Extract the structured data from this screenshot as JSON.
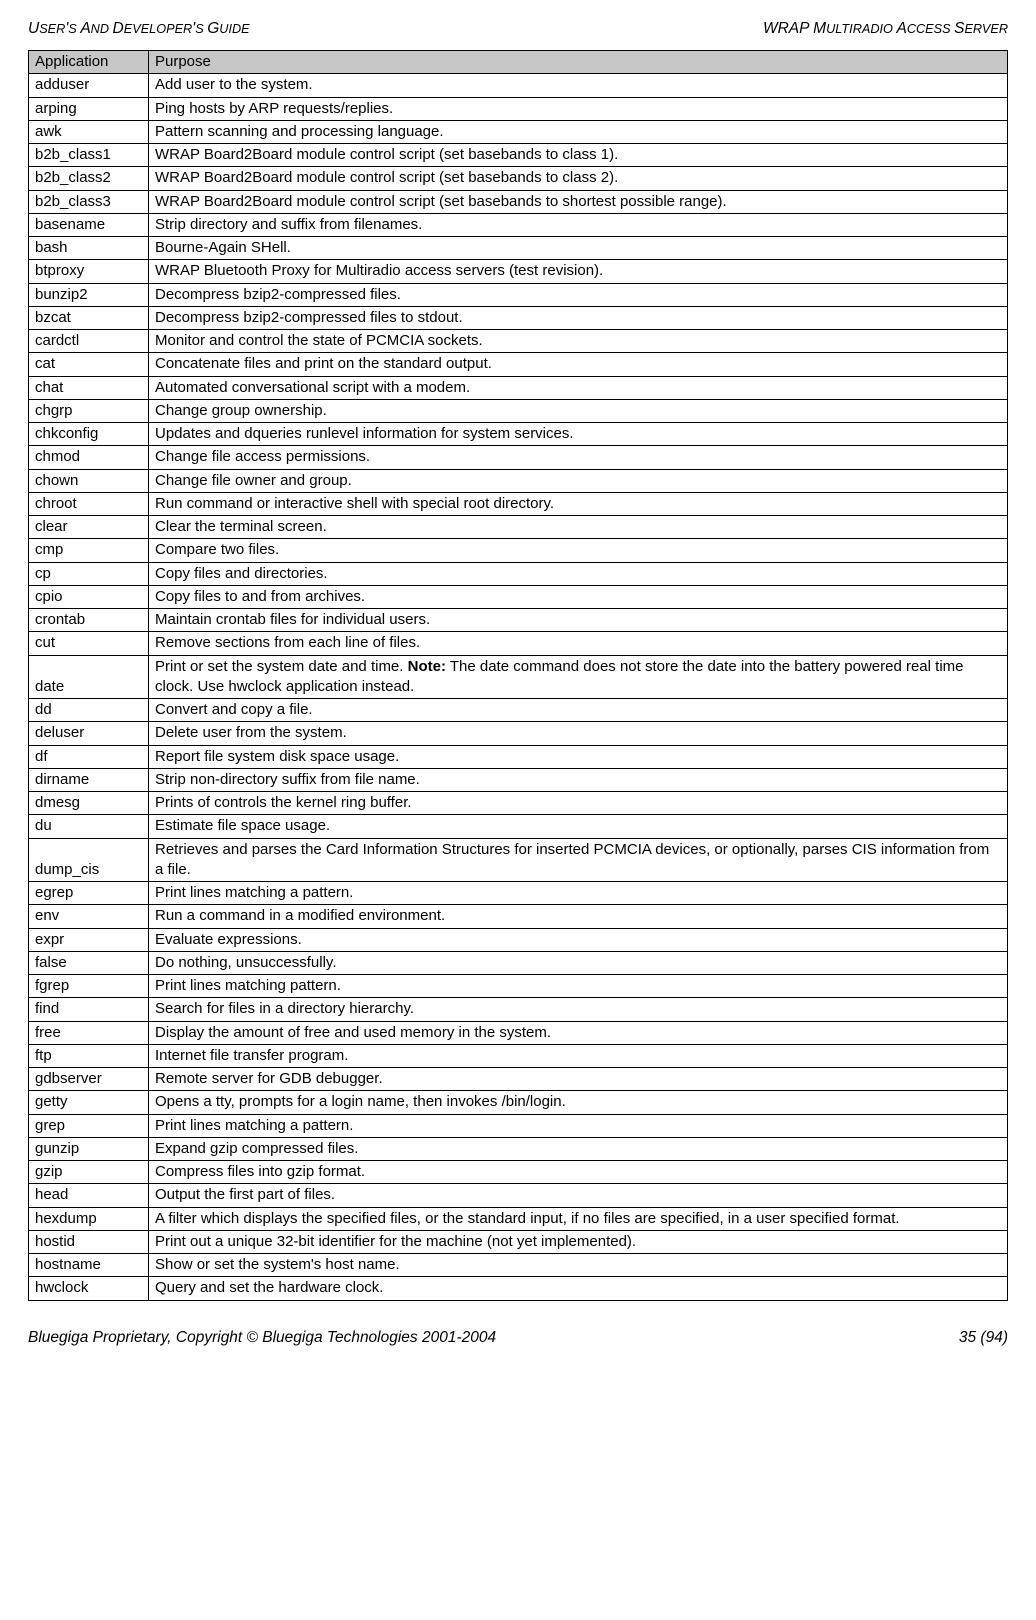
{
  "header": {
    "left_html": "U<span class='sc'>SER</span>'<span class='sc'>S</span> A<span class='sc'>ND</span> D<span class='sc'>EVELOPER</span>'<span class='sc'>S</span> G<span class='sc'>UIDE</span>",
    "left": "USER'S AND DEVELOPER'S GUIDE",
    "right": "WRAP MULTIRADIO ACCESS SERVER"
  },
  "table": {
    "headers": {
      "app": "Application",
      "purpose": "Purpose"
    },
    "rows": [
      {
        "app": "adduser",
        "purpose": "Add user to the system."
      },
      {
        "app": "arping",
        "purpose": "Ping hosts by ARP requests/replies."
      },
      {
        "app": "awk",
        "purpose": "Pattern scanning and processing language."
      },
      {
        "app": "b2b_class1",
        "purpose": "WRAP Board2Board module control script (set basebands to class 1)."
      },
      {
        "app": "b2b_class2",
        "purpose": "WRAP Board2Board module control script (set basebands to class 2)."
      },
      {
        "app": "b2b_class3",
        "purpose": "WRAP Board2Board module control script (set basebands to shortest possible range)."
      },
      {
        "app": "basename",
        "purpose": "Strip directory and suffix from filenames."
      },
      {
        "app": "bash",
        "purpose": "Bourne-Again SHell."
      },
      {
        "app": "btproxy",
        "purpose": "WRAP Bluetooth Proxy for Multiradio access servers (test revision)."
      },
      {
        "app": "bunzip2",
        "purpose": "Decompress bzip2-compressed files."
      },
      {
        "app": "bzcat",
        "purpose": "Decompress bzip2-compressed files to stdout."
      },
      {
        "app": "cardctl",
        "purpose": "Monitor and control the state of PCMCIA sockets."
      },
      {
        "app": "cat",
        "purpose": "Concatenate files and print on the standard output."
      },
      {
        "app": "chat",
        "purpose": "Automated conversational script with a modem."
      },
      {
        "app": "chgrp",
        "purpose": "Change group ownership."
      },
      {
        "app": "chkconfig",
        "purpose": "Updates and dqueries runlevel information for system services."
      },
      {
        "app": "chmod",
        "purpose": "Change file access permissions."
      },
      {
        "app": "chown",
        "purpose": "Change file owner and group."
      },
      {
        "app": "chroot",
        "purpose": "Run command or interactive shell with special root directory."
      },
      {
        "app": "clear",
        "purpose": "Clear the terminal screen."
      },
      {
        "app": "cmp",
        "purpose": "Compare two files."
      },
      {
        "app": "cp",
        "purpose": "Copy files and directories."
      },
      {
        "app": "cpio",
        "purpose": "Copy files to and from archives."
      },
      {
        "app": "crontab",
        "purpose": "Maintain crontab files for individual users."
      },
      {
        "app": "cut",
        "purpose": "Remove sections from each line of files."
      },
      {
        "app": "date",
        "purpose_html": "Print or set the system date and time. <b>Note:</b> The date command does not store the date into the battery powered real time clock. Use hwclock application instead."
      },
      {
        "app": "dd",
        "purpose": "Convert and copy a file."
      },
      {
        "app": "deluser",
        "purpose": "Delete user from the system."
      },
      {
        "app": "df",
        "purpose": "Report file system disk space usage."
      },
      {
        "app": "dirname",
        "purpose": "Strip non-directory suffix from file name."
      },
      {
        "app": "dmesg",
        "purpose": "Prints of controls the kernel ring buffer."
      },
      {
        "app": "du",
        "purpose": "Estimate file space usage."
      },
      {
        "app": "dump_cis",
        "purpose": "Retrieves and parses the Card Information Structures for inserted PCMCIA devices, or optionally, parses CIS information from a file."
      },
      {
        "app": "egrep",
        "purpose": "Print lines matching a pattern."
      },
      {
        "app": "env",
        "purpose": "Run a command in a modified environment."
      },
      {
        "app": "expr",
        "purpose": "Evaluate expressions."
      },
      {
        "app": "false",
        "purpose": "Do nothing, unsuccessfully."
      },
      {
        "app": "fgrep",
        "purpose": "Print lines matching pattern."
      },
      {
        "app": "find",
        "purpose": "Search for files in a directory hierarchy."
      },
      {
        "app": "free",
        "purpose": "Display the amount of free and used memory in the system."
      },
      {
        "app": "ftp",
        "purpose": "Internet file transfer program."
      },
      {
        "app": "gdbserver",
        "purpose": "Remote server for GDB debugger."
      },
      {
        "app": "getty",
        "purpose": "Opens a tty, prompts for a login name, then invokes /bin/login."
      },
      {
        "app": "grep",
        "purpose": "Print lines matching a pattern."
      },
      {
        "app": "gunzip",
        "purpose": "Expand gzip compressed files."
      },
      {
        "app": "gzip",
        "purpose": "Compress files into gzip format."
      },
      {
        "app": "head",
        "purpose": "Output the first part of files."
      },
      {
        "app": "hexdump",
        "purpose": "A filter which displays the specified files, or the standard input, if no files are specified, in a user specified format."
      },
      {
        "app": "hostid",
        "purpose": "Print out a unique 32-bit identifier for the machine (not yet implemented)."
      },
      {
        "app": "hostname",
        "purpose": "Show or set the system's host name."
      },
      {
        "app": "hwclock",
        "purpose": "Query and set the hardware clock."
      }
    ]
  },
  "footer": {
    "left": "Bluegiga Proprietary, Copyright © Bluegiga Technologies 2001-2004",
    "right": "35 (94)"
  }
}
